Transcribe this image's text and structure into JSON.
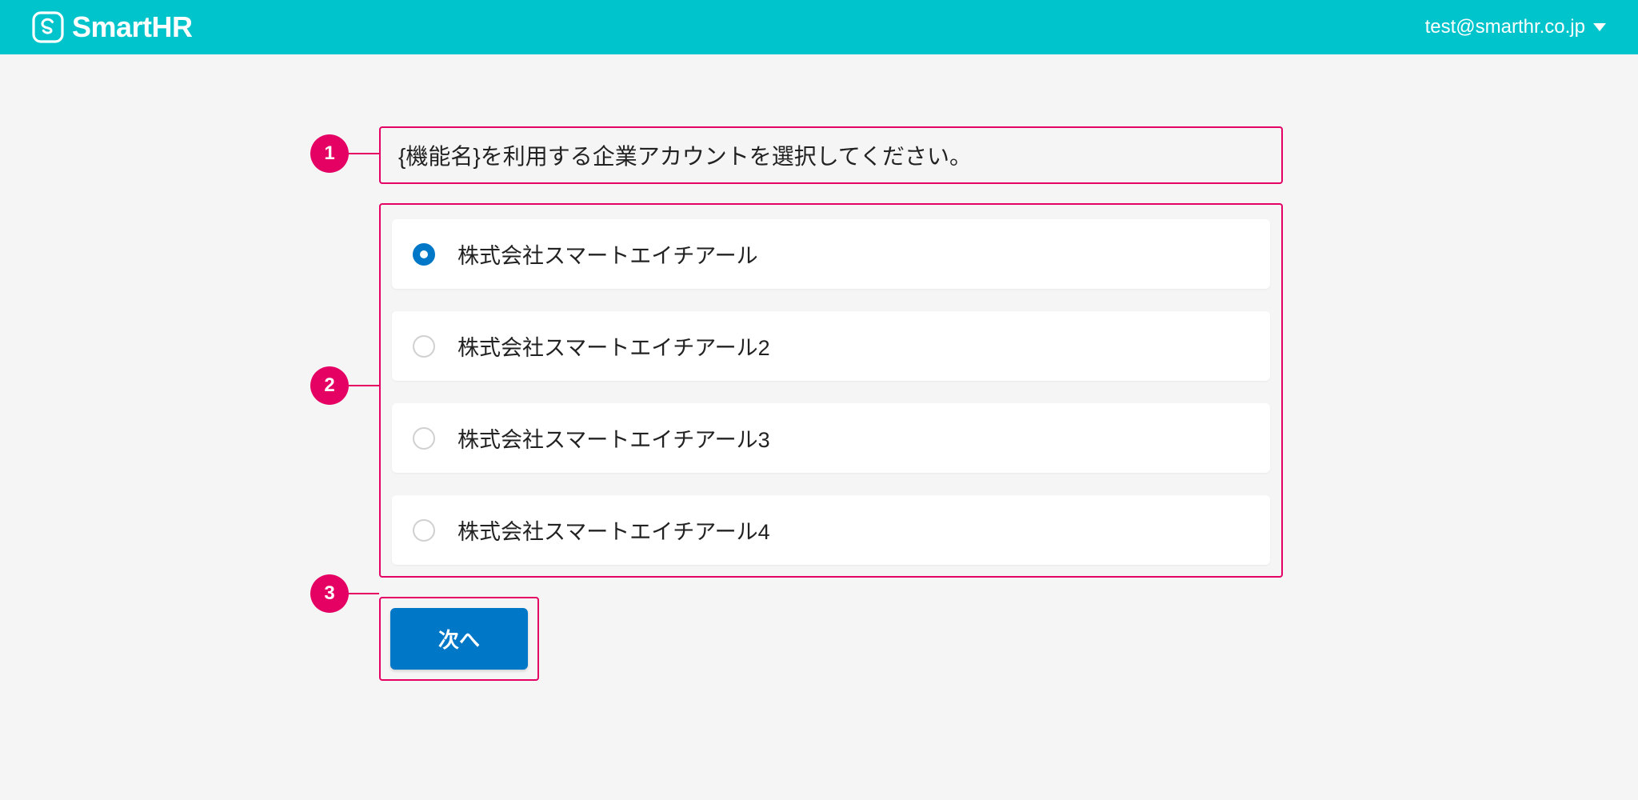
{
  "header": {
    "brand": "SmartHR",
    "user_email": "test@smarthr.co.jp"
  },
  "instruction": "{機能名}を利用する企業アカウントを選択してください。",
  "options": [
    {
      "label": "株式会社スマートエイチアール",
      "selected": true
    },
    {
      "label": "株式会社スマートエイチアール2",
      "selected": false
    },
    {
      "label": "株式会社スマートエイチアール3",
      "selected": false
    },
    {
      "label": "株式会社スマートエイチアール4",
      "selected": false
    }
  ],
  "next_button": "次へ",
  "annotations": [
    {
      "num": "1"
    },
    {
      "num": "2"
    },
    {
      "num": "3"
    }
  ]
}
